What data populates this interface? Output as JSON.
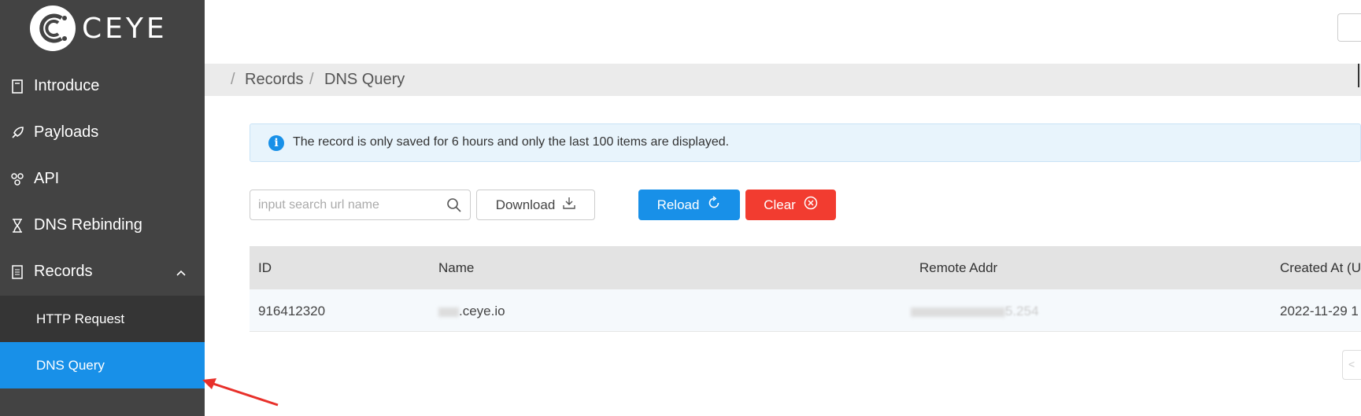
{
  "app": {
    "logo_text": "CEYE"
  },
  "sidebar": {
    "items": [
      {
        "label": "Introduce",
        "icon": "book-icon"
      },
      {
        "label": "Payloads",
        "icon": "rocket-icon"
      },
      {
        "label": "API",
        "icon": "api-icon"
      },
      {
        "label": "DNS Rebinding",
        "icon": "hourglass-icon"
      },
      {
        "label": "Records",
        "icon": "records-icon",
        "expanded": true
      }
    ],
    "subitems": [
      {
        "label": "HTTP Request"
      },
      {
        "label": "DNS Query",
        "active": true
      }
    ]
  },
  "breadcrumb": {
    "sep": "/",
    "level1": "Records",
    "level2": "DNS Query"
  },
  "alert": {
    "text": "The record is only saved for 6 hours and only the last 100 items are displayed."
  },
  "toolbar": {
    "search_placeholder": "input search url name",
    "download_label": "Download",
    "reload_label": "Reload",
    "clear_label": "Clear"
  },
  "table": {
    "columns": [
      "ID",
      "Name",
      "Remote Addr",
      "Created At (U"
    ],
    "rows": [
      {
        "id": "916412320",
        "name_suffix": ".ceye.io",
        "addr_suffix": "5.254",
        "created": "2022-11-29 1"
      }
    ]
  },
  "colors": {
    "sidebar": "#434343",
    "active": "#1890e8",
    "danger": "#f23c30"
  }
}
